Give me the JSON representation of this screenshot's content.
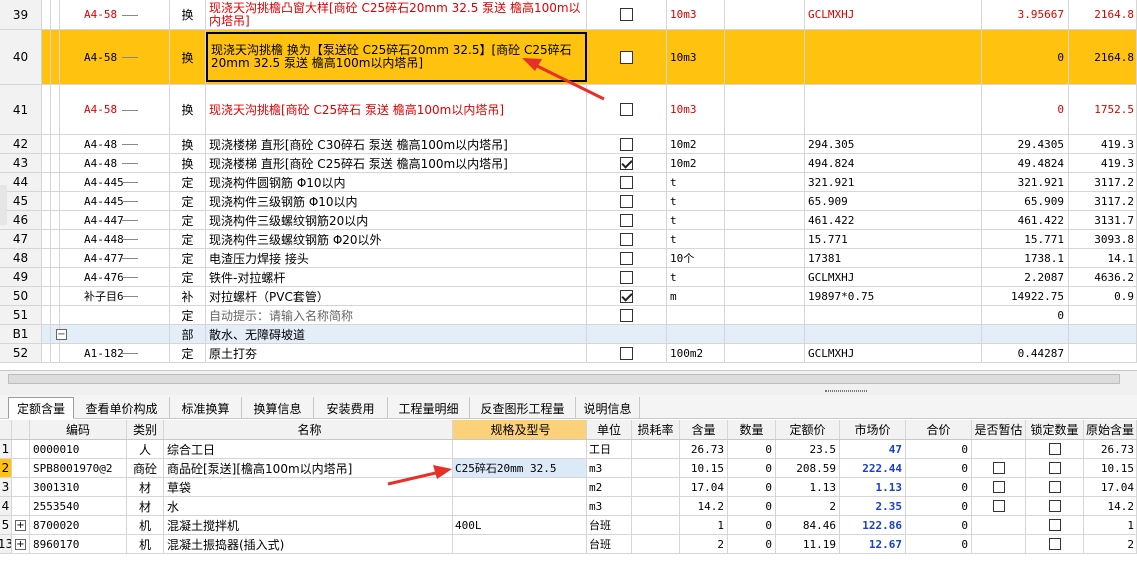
{
  "top_rows": [
    {
      "no": "39",
      "code": "A4-58",
      "type": "换",
      "name": "现浇天沟挑檐凸窗大样[商砼 C25碎石20mm 32.5 泵送 檐高100m以内塔吊]",
      "checked": false,
      "unit": "10m3",
      "expr": "GCLMXHJ",
      "qty": "3.95667",
      "price": "2164.8",
      "red": true
    },
    {
      "no": "40",
      "code": "A4-58",
      "type": "换",
      "name": "现浇天沟挑檐  换为【泵送砼 C25碎石20mm 32.5】[商砼 C25碎石20mm 32.5 泵送 檐高100m以内塔吊]",
      "checked": false,
      "unit": "10m3",
      "expr": "",
      "qty": "0",
      "price": "2164.8",
      "red": false
    },
    {
      "no": "41",
      "code": "A4-58",
      "type": "换",
      "name": "现浇天沟挑檐[商砼 C25碎石 泵送 檐高100m以内塔吊]",
      "checked": false,
      "unit": "10m3",
      "expr": "",
      "qty": "0",
      "price": "1752.5",
      "red": true
    },
    {
      "no": "42",
      "code": "A4-48",
      "type": "换",
      "name": "现浇楼梯 直形[商砼 C30碎石 泵送 檐高100m以内塔吊]",
      "checked": false,
      "unit": "10m2",
      "expr": "294.305",
      "qty": "29.4305",
      "price": "419.3",
      "red": false
    },
    {
      "no": "43",
      "code": "A4-48",
      "type": "换",
      "name": "现浇楼梯 直形[商砼 C25碎石 泵送 檐高100m以内塔吊]",
      "checked": true,
      "unit": "10m2",
      "expr": "494.824",
      "qty": "49.4824",
      "price": "419.3",
      "red": false
    },
    {
      "no": "44",
      "code": "A4-445",
      "type": "定",
      "name": "现浇构件圆钢筋 Φ10以内",
      "checked": false,
      "unit": "t",
      "expr": "321.921",
      "qty": "321.921",
      "price": "3117.2",
      "red": false
    },
    {
      "no": "45",
      "code": "A4-445",
      "type": "定",
      "name": "现浇构件三级钢筋 Φ10以内",
      "checked": false,
      "unit": "t",
      "expr": "65.909",
      "qty": "65.909",
      "price": "3117.2",
      "red": false
    },
    {
      "no": "46",
      "code": "A4-447",
      "type": "定",
      "name": "现浇构件三级螺纹钢筋20以内",
      "checked": false,
      "unit": "t",
      "expr": "461.422",
      "qty": "461.422",
      "price": "3131.7",
      "red": false
    },
    {
      "no": "47",
      "code": "A4-448",
      "type": "定",
      "name": "现浇构件三级螺纹钢筋 Φ20以外",
      "checked": false,
      "unit": "t",
      "expr": "15.771",
      "qty": "15.771",
      "price": "3093.8",
      "red": false
    },
    {
      "no": "48",
      "code": "A4-477",
      "type": "定",
      "name": "电渣压力焊接 接头",
      "checked": false,
      "unit": "10个",
      "expr": "17381",
      "qty": "1738.1",
      "price": "14.1",
      "red": false
    },
    {
      "no": "49",
      "code": "A4-476",
      "type": "定",
      "name": "铁件-对拉螺杆",
      "checked": false,
      "unit": "t",
      "expr": "GCLMXHJ",
      "qty": "2.2087",
      "price": "4636.2",
      "red": false
    },
    {
      "no": "50",
      "code": "补子目6",
      "type": "补",
      "name": "对拉螺杆（PVC套管）",
      "checked": true,
      "unit": "m",
      "expr": "19897*0.75",
      "qty": "14922.75",
      "price": "0.9",
      "red": false
    },
    {
      "no": "51",
      "code": "",
      "type": "定",
      "name": "自动提示：请输入名称简称",
      "checked": false,
      "unit": "",
      "expr": "",
      "qty": "0",
      "price": "",
      "red": false
    },
    {
      "no": "B1",
      "code": "",
      "type": "部",
      "name": "散水、无障碍坡道",
      "checked": null,
      "unit": "",
      "expr": "",
      "qty": "",
      "price": "",
      "red": false
    },
    {
      "no": "52",
      "code": "A1-182",
      "type": "定",
      "name": "原土打夯",
      "checked": false,
      "unit": "100m2",
      "expr": "GCLMXHJ",
      "qty": "0.44287",
      "price": "",
      "red": false
    }
  ],
  "section_toggle": "−",
  "tabs": [
    "定额含量",
    "查看单价构成",
    "标准换算",
    "换算信息",
    "安装费用",
    "工程量明细",
    "反查图形工程量",
    "说明信息"
  ],
  "bottom_headers": {
    "code": "编码",
    "cat": "类别",
    "name": "名称",
    "spec": "规格及型号",
    "unit": "单位",
    "loss": "损耗率",
    "hl": "含量",
    "num": "数量",
    "dej": "定额价",
    "mkt": "市场价",
    "sum": "合价",
    "temp": "是否暂估",
    "lock": "锁定数量",
    "orig": "原始含量"
  },
  "bottom_rows": [
    {
      "no": "1",
      "exp": "",
      "code": "0000010",
      "cat": "人",
      "name": "综合工日",
      "spec": "",
      "unit": "工日",
      "hl": "26.73",
      "num": "0",
      "dej": "23.5",
      "mkt": "47",
      "sum": "0",
      "temp": null,
      "lock": false,
      "orig": "26.73"
    },
    {
      "no": "2",
      "exp": "",
      "code": "SPB8001970@2",
      "cat": "商砼",
      "name": "商品砼[泵送][檐高100m以内塔吊]",
      "spec": "C25碎石20mm 32.5",
      "unit": "m3",
      "hl": "10.15",
      "num": "0",
      "dej": "208.59",
      "mkt": "222.44",
      "sum": "0",
      "temp": false,
      "lock": false,
      "orig": "10.15"
    },
    {
      "no": "3",
      "exp": "",
      "code": "3001310",
      "cat": "材",
      "name": "草袋",
      "spec": "",
      "unit": "m2",
      "hl": "17.04",
      "num": "0",
      "dej": "1.13",
      "mkt": "1.13",
      "sum": "0",
      "temp": false,
      "lock": false,
      "orig": "17.04"
    },
    {
      "no": "4",
      "exp": "",
      "code": "2553540",
      "cat": "材",
      "name": "水",
      "spec": "",
      "unit": "m3",
      "hl": "14.2",
      "num": "0",
      "dej": "2",
      "mkt": "2.35",
      "sum": "0",
      "temp": false,
      "lock": false,
      "orig": "14.2"
    },
    {
      "no": "5",
      "exp": "+",
      "code": "8700020",
      "cat": "机",
      "name": "混凝土搅拌机",
      "spec": "400L",
      "unit": "台班",
      "hl": "1",
      "num": "0",
      "dej": "84.46",
      "mkt": "122.86",
      "sum": "0",
      "temp": null,
      "lock": false,
      "orig": "1"
    },
    {
      "no": "13",
      "exp": "+",
      "code": "8960170",
      "cat": "机",
      "name": "混凝土振捣器(插入式)",
      "spec": "",
      "unit": "台班",
      "hl": "2",
      "num": "0",
      "dej": "11.19",
      "mkt": "12.67",
      "sum": "0",
      "temp": null,
      "lock": false,
      "orig": "2"
    }
  ],
  "colors": {
    "highlight_row": "#ffc20e",
    "section_row": "#e3eef9",
    "red_text": "#e00000",
    "market_price": "#1a3fd0",
    "arrow": "#e8302a"
  },
  "icons": {
    "row_checkbox": "checkbox-icon",
    "expand": "plus-box-icon",
    "collapse": "minus-box-icon",
    "pointer": "red-arrow-icon"
  }
}
